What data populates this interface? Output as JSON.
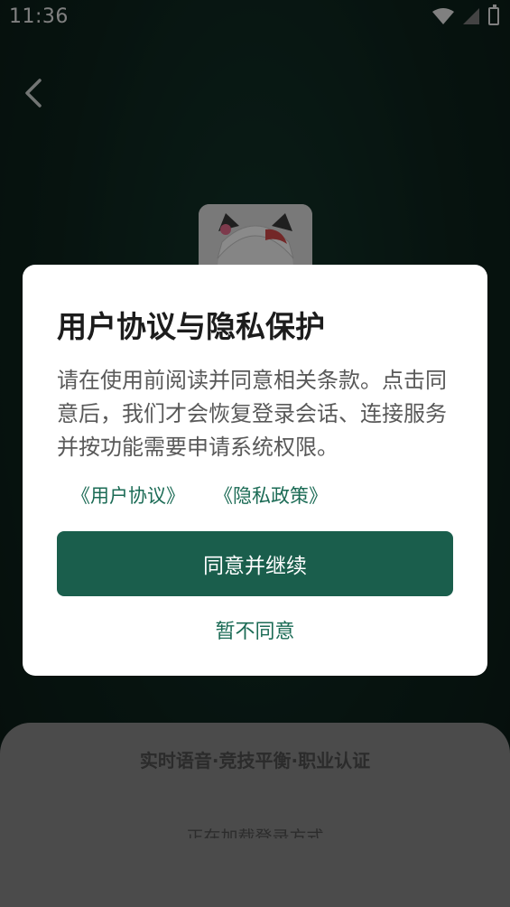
{
  "status_bar": {
    "time": "11:36",
    "icons": [
      "wifi-icon",
      "signal-icon",
      "battery-icon"
    ]
  },
  "navigation": {
    "back_icon": "back-icon"
  },
  "background": {
    "avatar": "avatar"
  },
  "bottom_sheet": {
    "tagline": "实时语音·竞技平衡·职业认证",
    "loading_text": "正在加载登录方式"
  },
  "dialog": {
    "title": "用户协议与隐私保护",
    "body": "请在使用前阅读并同意相关条款。点击同意后，我们才会恢复登录会话、连接服务并按功能需要申请系统权限。",
    "links": {
      "user_agreement": "《用户协议》",
      "privacy_policy": "《隐私政策》"
    },
    "agree_label": "同意并继续",
    "decline_label": "暂不同意"
  },
  "colors": {
    "accent": "#1a5e4c",
    "link": "#1b6b55",
    "dialog_bg": "#ffffff",
    "sheet_bg": "#4b4b4b"
  }
}
